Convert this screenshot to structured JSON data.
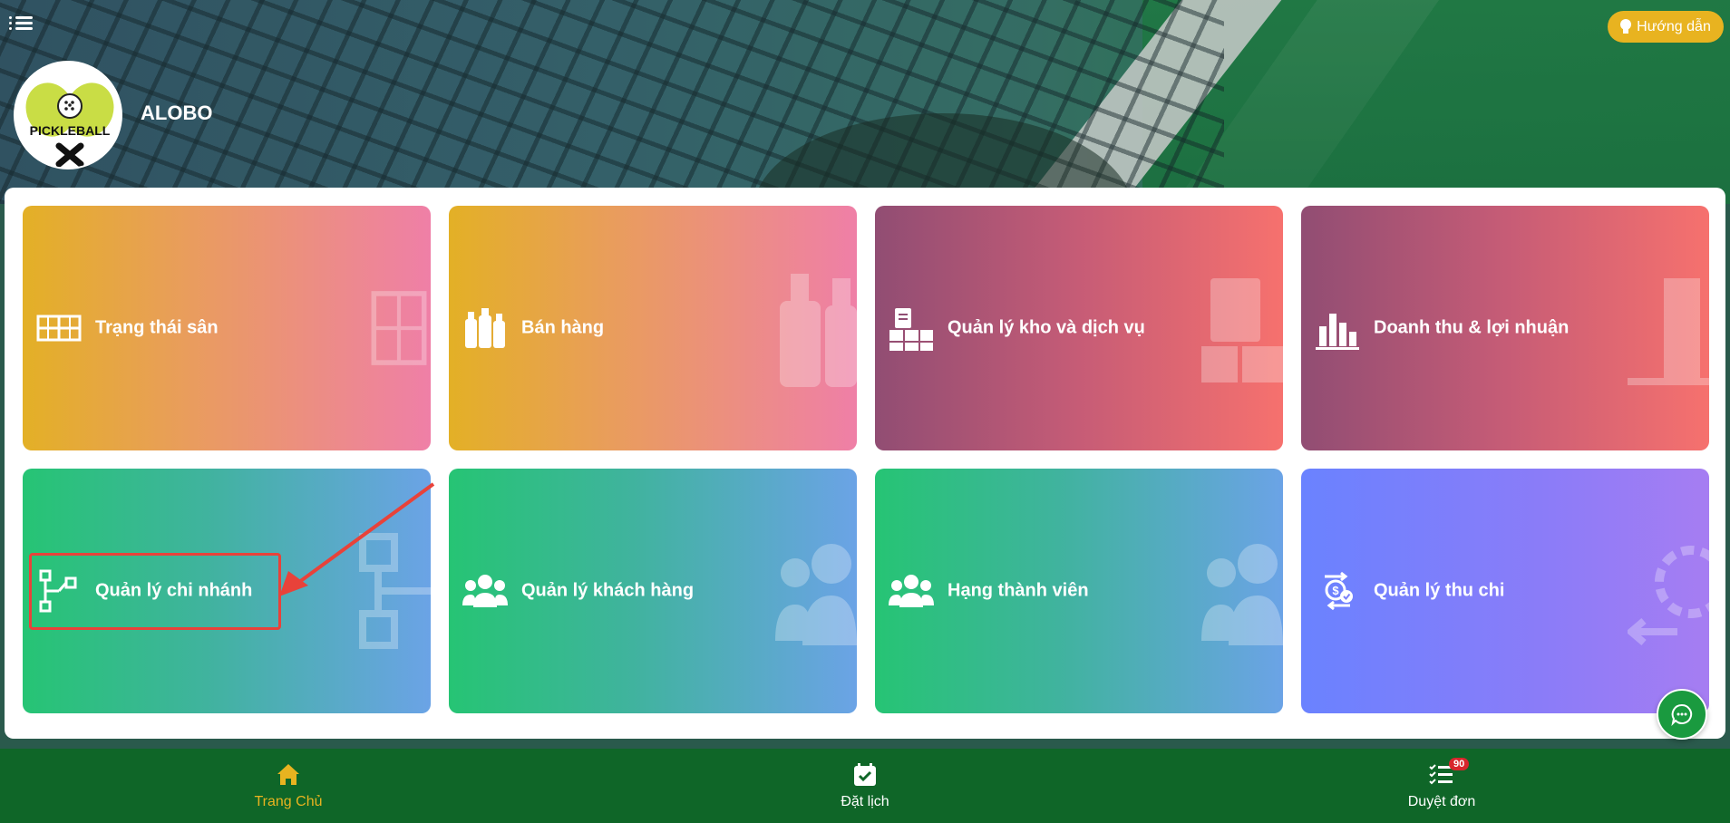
{
  "header": {
    "menu_icon": "hamburger-menu-icon",
    "guide_button_label": "Hướng dẫn",
    "brand_name": "ALOBO",
    "logo_text": "PICKLEBALL"
  },
  "cards": [
    {
      "label": "Trạng thái sân",
      "icon": "court-grid-icon"
    },
    {
      "label": "Bán hàng",
      "icon": "bottles-icon"
    },
    {
      "label": "Quản lý kho và dịch vụ",
      "icon": "clipboard-boxes-icon"
    },
    {
      "label": "Doanh thu & lợi nhuận",
      "icon": "bar-chart-icon"
    },
    {
      "label": "Quản lý chi nhánh",
      "icon": "branch-tree-icon"
    },
    {
      "label": "Quản lý khách hàng",
      "icon": "users-icon"
    },
    {
      "label": "Hạng thành viên",
      "icon": "users-icon"
    },
    {
      "label": "Quản lý thu chi",
      "icon": "money-cycle-icon"
    }
  ],
  "bottom_nav": {
    "items": [
      {
        "label": "Trang Chủ",
        "icon": "home-icon",
        "active": true
      },
      {
        "label": "Đặt lịch",
        "icon": "calendar-check-icon",
        "active": false
      },
      {
        "label": "Duyệt đơn",
        "icon": "checklist-icon",
        "active": false,
        "badge": "90"
      }
    ]
  },
  "colors": {
    "accent_yellow": "#e8b320",
    "nav_green": "#0f6628",
    "highlight_red": "#e8423a"
  }
}
